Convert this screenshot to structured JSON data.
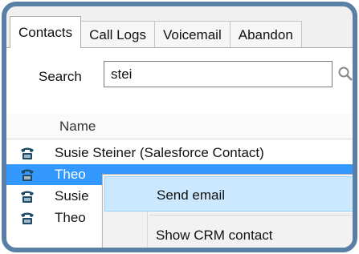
{
  "tabs": [
    {
      "label": "Contacts",
      "active": true
    },
    {
      "label": "Call Logs",
      "active": false
    },
    {
      "label": "Voicemail",
      "active": false
    },
    {
      "label": "Abandon",
      "active": false
    }
  ],
  "search": {
    "label": "Search",
    "value": "stei"
  },
  "grid": {
    "header": {
      "name": "Name"
    },
    "rows": [
      {
        "name": "Susie Steiner (Salesforce Contact)",
        "icon": "phone-icon",
        "selected": false
      },
      {
        "name": "Theo",
        "icon": "phone-icon",
        "selected": true
      },
      {
        "name": "Susie",
        "icon": "phone-icon",
        "selected": false
      },
      {
        "name": "Theo",
        "icon": "phone-icon",
        "selected": false
      }
    ]
  },
  "context_menu": {
    "items": [
      {
        "label": "Send email",
        "highlighted": true
      },
      {
        "label": "Show CRM contact",
        "highlighted": false
      }
    ]
  },
  "colors": {
    "frame": "#5a7fa6",
    "selection": "#3399ff",
    "menu_highlight": "#cce8ff"
  }
}
